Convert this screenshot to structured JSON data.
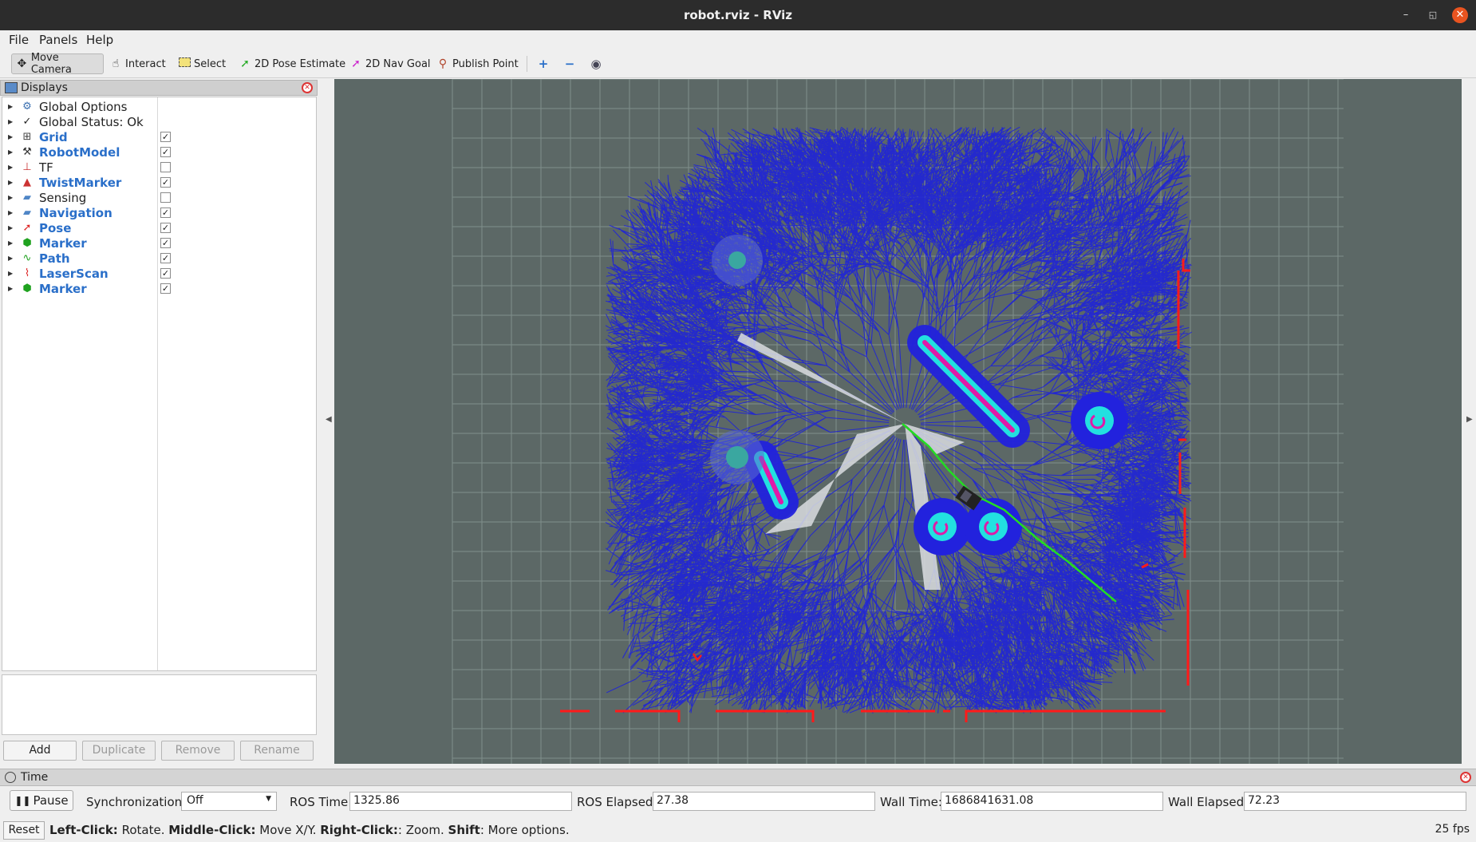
{
  "window": {
    "title": "robot.rviz - RViz",
    "min": "–",
    "max": "◱",
    "close": "✕"
  },
  "menu": {
    "file": "File",
    "panels": "Panels",
    "help": "Help"
  },
  "toolbar": {
    "move_camera": "Move Camera",
    "interact": "Interact",
    "select": "Select",
    "pose_estimate": "2D Pose Estimate",
    "nav_goal": "2D Nav Goal",
    "publish_point": "Publish Point",
    "zoom_in": "+",
    "zoom_out": "−",
    "eye": "◉"
  },
  "displays": {
    "title": "Displays",
    "items": [
      {
        "label": "Global Options",
        "icon": "gear-icon",
        "blue": false,
        "checkbox": null
      },
      {
        "label": "Global Status: Ok",
        "icon": "check-icon",
        "blue": false,
        "checkbox": null
      },
      {
        "label": "Grid",
        "icon": "grid-icon",
        "blue": true,
        "checkbox": true
      },
      {
        "label": "RobotModel",
        "icon": "robot-icon",
        "blue": true,
        "checkbox": true
      },
      {
        "label": "TF",
        "icon": "axes-icon",
        "blue": false,
        "checkbox": false
      },
      {
        "label": "TwistMarker",
        "icon": "marker-icon",
        "blue": true,
        "checkbox": true
      },
      {
        "label": "Sensing",
        "icon": "folder-icon",
        "blue": false,
        "checkbox": false
      },
      {
        "label": "Navigation",
        "icon": "folder-icon",
        "blue": true,
        "checkbox": true
      },
      {
        "label": "Pose",
        "icon": "arrow-icon",
        "blue": true,
        "checkbox": true
      },
      {
        "label": "Marker",
        "icon": "cube-icon",
        "blue": true,
        "checkbox": true
      },
      {
        "label": "Path",
        "icon": "path-icon",
        "blue": true,
        "checkbox": true
      },
      {
        "label": "LaserScan",
        "icon": "laser-icon",
        "blue": true,
        "checkbox": true
      },
      {
        "label": "Marker",
        "icon": "cube-icon",
        "blue": true,
        "checkbox": true
      }
    ],
    "buttons": {
      "add": "Add",
      "duplicate": "Duplicate",
      "remove": "Remove",
      "rename": "Rename"
    }
  },
  "time": {
    "title": "Time",
    "pause": "Pause",
    "sync_label": "Synchronization:",
    "sync_value": "Off",
    "ros_time_label": "ROS Time:",
    "ros_time": "1325.86",
    "ros_elapsed_label": "ROS Elapsed:",
    "ros_elapsed": "27.38",
    "wall_time_label": "Wall Time:",
    "wall_time": "1686841631.08",
    "wall_elapsed_label": "Wall Elapsed:",
    "wall_elapsed": "72.23"
  },
  "status": {
    "reset": "Reset",
    "left_click": "Left-Click:",
    "left_click_desc": " Rotate. ",
    "middle_click": "Middle-Click:",
    "middle_click_desc": " Move X/Y. ",
    "right_click": "Right-Click:",
    "right_click_desc": ": Zoom. ",
    "shift": "Shift",
    "shift_desc": ": More options.",
    "fps": "25 fps"
  },
  "colors": {
    "viewport_bg": "#5c6866",
    "grid": "#8a9896",
    "tree": "#1e22d8",
    "laser": "#ff1a1a",
    "path": "#22dd22",
    "costmap_outer": "#2222dd",
    "costmap_inner": "#22e0e0"
  }
}
